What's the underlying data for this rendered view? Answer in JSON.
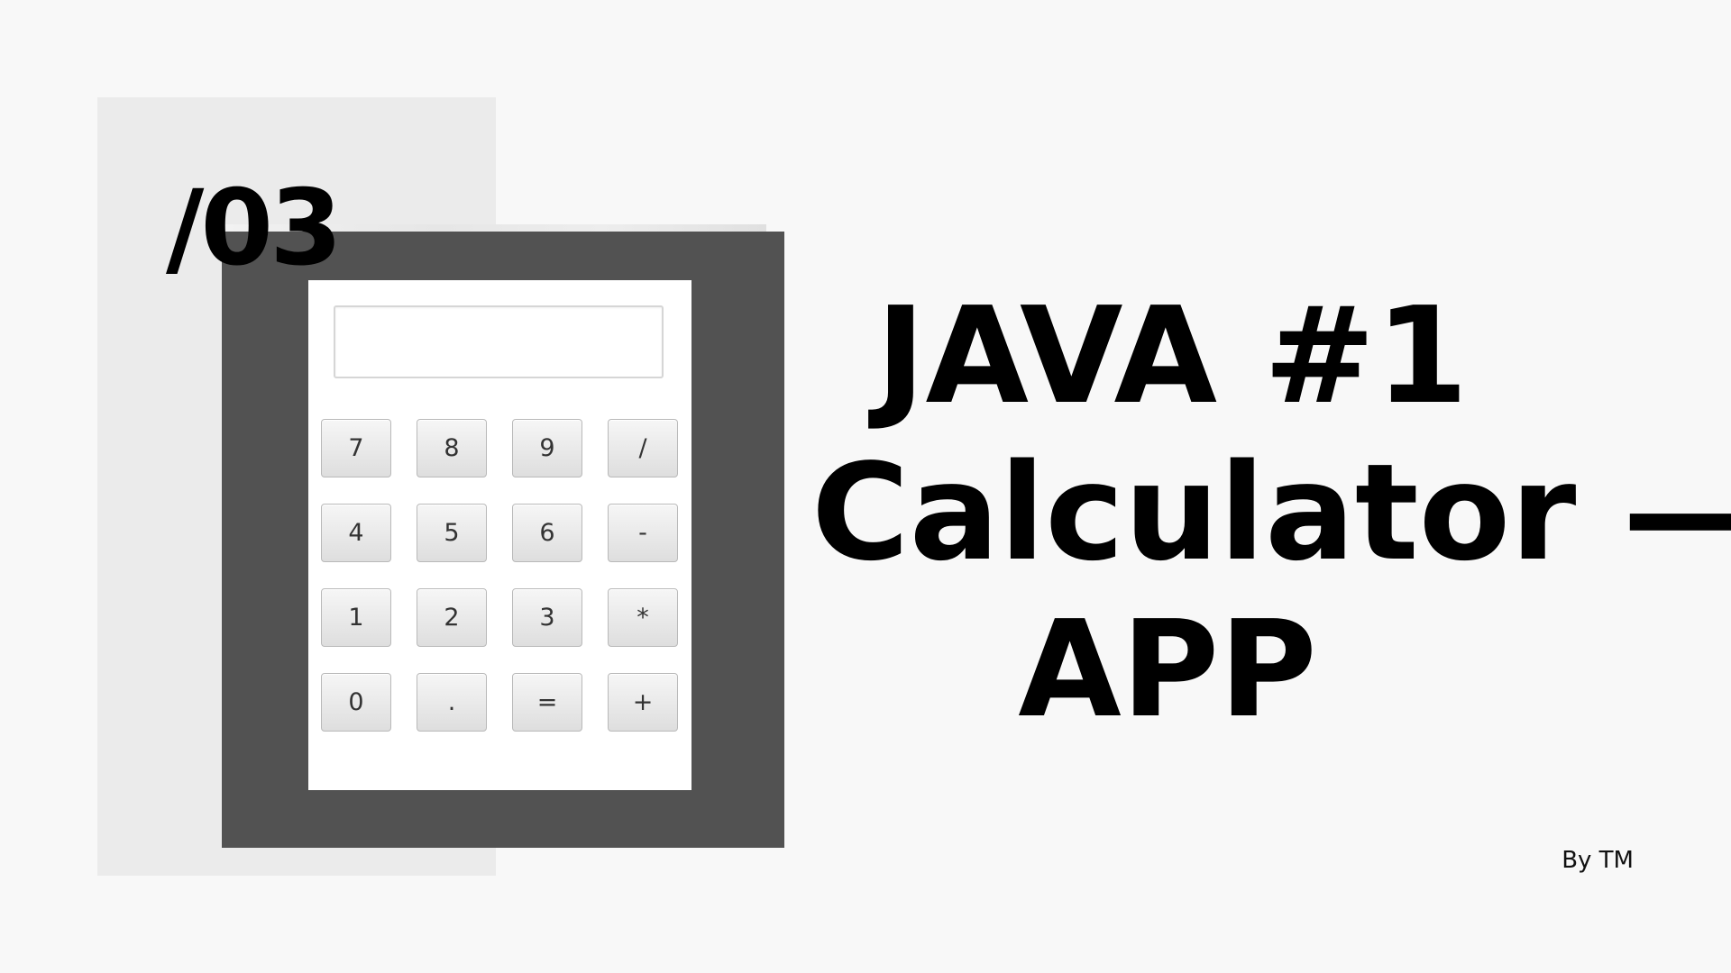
{
  "slide": {
    "section_number": "/03",
    "title_lines": [
      "JAVA #1",
      "Calculator —",
      "APP"
    ],
    "byline": "By TM"
  },
  "calculator": {
    "display_value": "",
    "keys": [
      "7",
      "8",
      "9",
      "/",
      "4",
      "5",
      "6",
      "-",
      "1",
      "2",
      "3",
      "*",
      "0",
      ".",
      "=",
      "+"
    ]
  },
  "colors": {
    "background": "#f8f8f8",
    "panel": "#ebebeb",
    "frame": "#525252",
    "window": "#ffffff",
    "text": "#000000"
  }
}
